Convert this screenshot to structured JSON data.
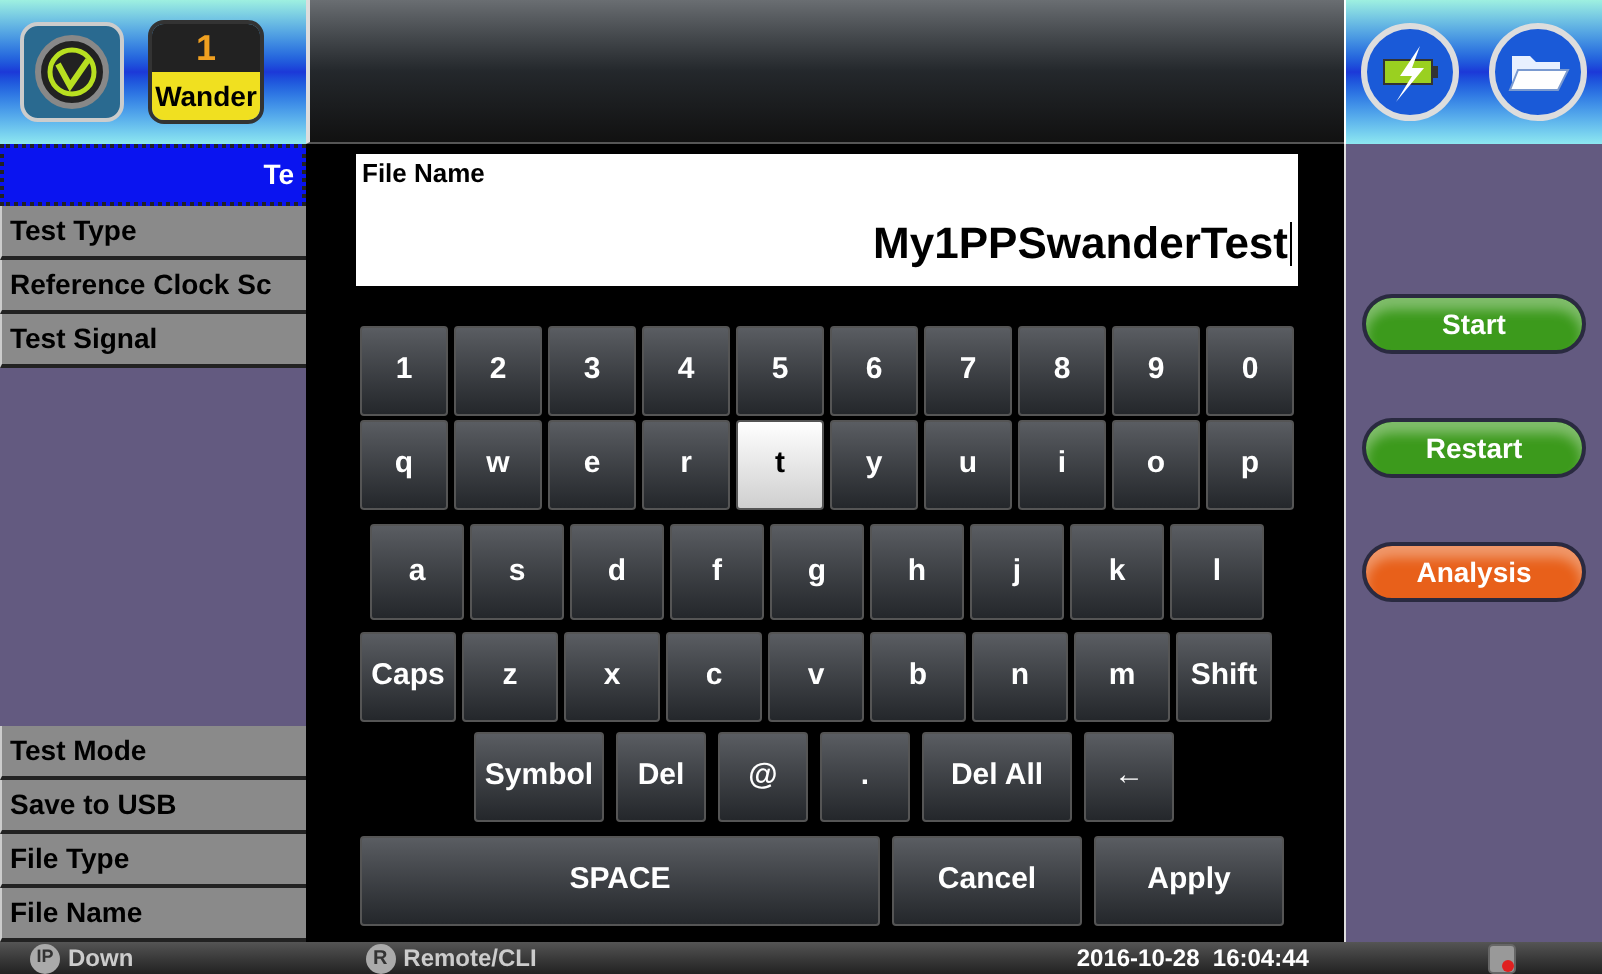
{
  "header": {
    "badge": {
      "number": "1",
      "label": "Wander"
    }
  },
  "sidebar": {
    "top_items": [
      {
        "label": "Te",
        "selected": true
      },
      {
        "label": "Test Type",
        "selected": false
      },
      {
        "label": "Reference Clock Sc",
        "selected": false
      },
      {
        "label": "Test Signal",
        "selected": false
      }
    ],
    "bottom_items": [
      {
        "label": "Test Mode",
        "selected": false
      },
      {
        "label": "Save to USB",
        "selected": false
      },
      {
        "label": "File Type",
        "selected": false
      },
      {
        "label": "File Name",
        "selected": false
      }
    ]
  },
  "file_name": {
    "label": "File Name",
    "value": "My1PPSwanderTest"
  },
  "keyboard": {
    "digit_keys": [
      {
        "label": "1",
        "selected": false
      },
      {
        "label": "2",
        "selected": false
      },
      {
        "label": "3",
        "selected": false
      },
      {
        "label": "4",
        "selected": false
      },
      {
        "label": "5",
        "selected": false
      },
      {
        "label": "6",
        "selected": false
      },
      {
        "label": "7",
        "selected": false
      },
      {
        "label": "8",
        "selected": false
      },
      {
        "label": "9",
        "selected": false
      },
      {
        "label": "0",
        "selected": false
      }
    ],
    "upper_letter_keys": [
      {
        "label": "q",
        "selected": false
      },
      {
        "label": "w",
        "selected": false
      },
      {
        "label": "e",
        "selected": false
      },
      {
        "label": "r",
        "selected": false
      },
      {
        "label": "t",
        "selected": true
      },
      {
        "label": "y",
        "selected": false
      },
      {
        "label": "u",
        "selected": false
      },
      {
        "label": "i",
        "selected": false
      },
      {
        "label": "o",
        "selected": false
      },
      {
        "label": "p",
        "selected": false
      }
    ],
    "middle_letter_keys": [
      {
        "label": "a",
        "selected": false
      },
      {
        "label": "s",
        "selected": false
      },
      {
        "label": "d",
        "selected": false
      },
      {
        "label": "f",
        "selected": false
      },
      {
        "label": "g",
        "selected": false
      },
      {
        "label": "h",
        "selected": false
      },
      {
        "label": "j",
        "selected": false
      },
      {
        "label": "k",
        "selected": false
      },
      {
        "label": "l",
        "selected": false
      }
    ],
    "lower_letter_keys": [
      {
        "label": "Caps",
        "selected": false
      },
      {
        "label": "z",
        "selected": false
      },
      {
        "label": "x",
        "selected": false
      },
      {
        "label": "c",
        "selected": false
      },
      {
        "label": "v",
        "selected": false
      },
      {
        "label": "b",
        "selected": false
      },
      {
        "label": "n",
        "selected": false
      },
      {
        "label": "m",
        "selected": false
      },
      {
        "label": "Shift",
        "selected": false
      }
    ],
    "edit_keys": [
      {
        "label": "Symbol",
        "selected": false
      },
      {
        "label": "Del",
        "selected": false
      },
      {
        "label": "@",
        "selected": false
      },
      {
        "label": ".",
        "selected": false
      },
      {
        "label": "Del All",
        "selected": false
      },
      {
        "label": "←",
        "selected": false
      }
    ],
    "bottom_keys": [
      {
        "label": "SPACE",
        "selected": false
      },
      {
        "label": "Cancel",
        "selected": false
      },
      {
        "label": "Apply",
        "selected": false
      }
    ]
  },
  "actions": [
    {
      "label": "Start",
      "color": "#3c9a1c"
    },
    {
      "label": "Restart",
      "color": "#3c9a1c"
    },
    {
      "label": "Analysis",
      "color": "#e8601a"
    }
  ],
  "status_bar": {
    "ip_icon": "IP",
    "ip_status": "Down",
    "remote_icon": "R",
    "remote_label": "Remote/CLI",
    "datetime": "2016-10-28  16:04:44"
  }
}
